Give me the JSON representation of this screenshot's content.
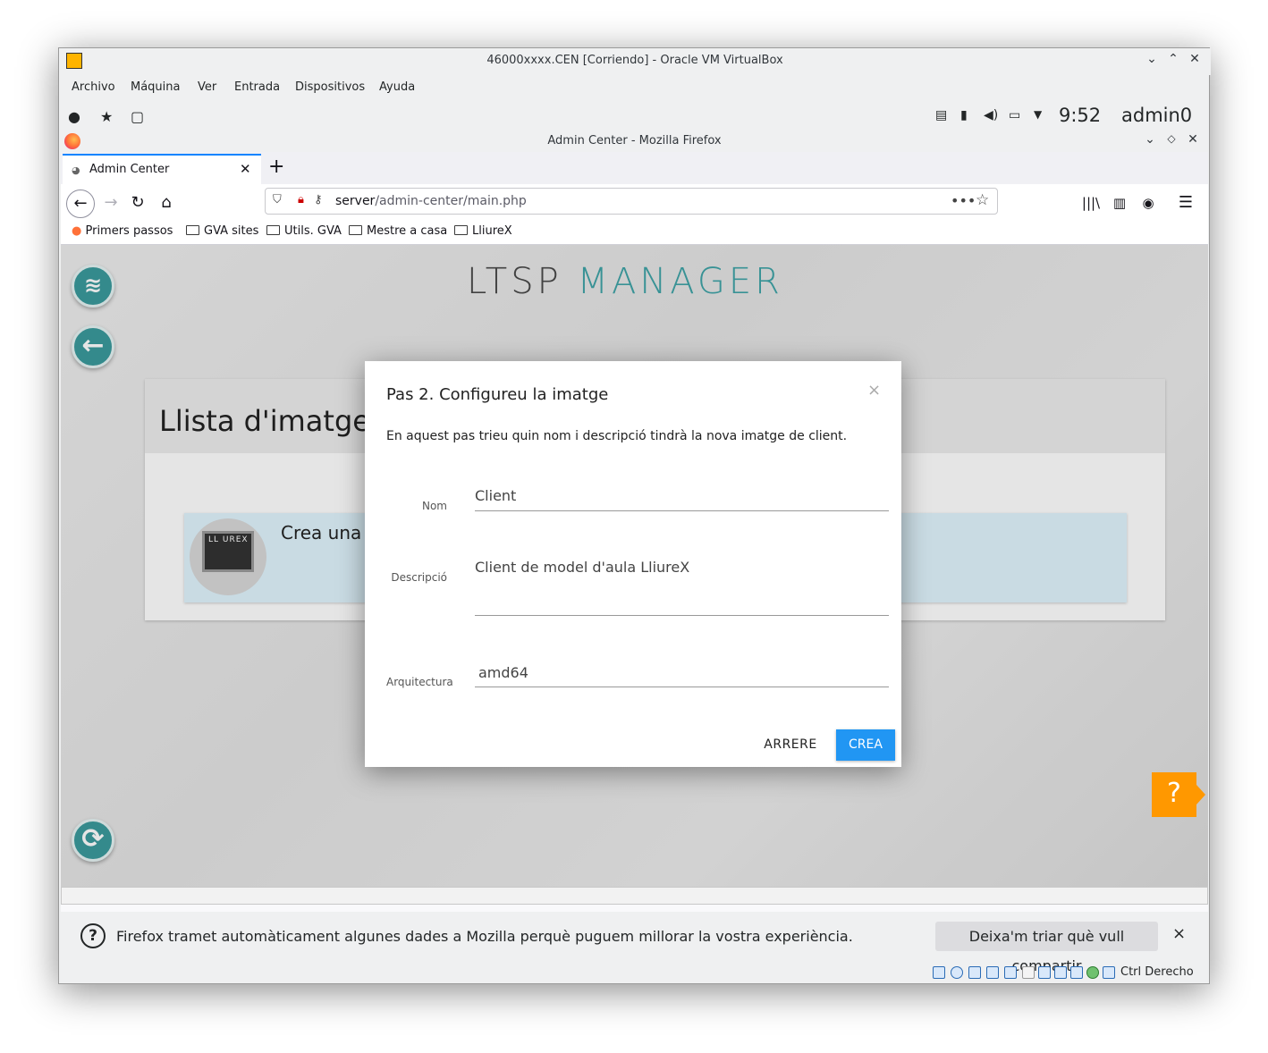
{
  "vbox": {
    "title": "46000xxxx.CEN [Corriendo] - Oracle VM VirtualBox",
    "menu": [
      "Archivo",
      "Máquina",
      "Ver",
      "Entrada",
      "Dispositivos",
      "Ayuda"
    ],
    "clock": "9:52",
    "user": "admin0",
    "host_key": "Ctrl Derecho"
  },
  "firefox": {
    "title": "Admin Center - Mozilla Firefox",
    "tab_label": "Admin Center",
    "url_host": "server",
    "url_path": "/admin-center/main.php",
    "bookmarks": [
      "Primers passos",
      "GVA sites",
      "Utils. GVA",
      "Mestre a casa",
      "LliureX"
    ]
  },
  "page": {
    "logo_left": "LTSP",
    "logo_right": "MANAGER",
    "card_title": "Llista d'imatges",
    "item_text": "Crea una n",
    "item_image_text": "LL UREX",
    "help": "?"
  },
  "modal": {
    "title": "Pas 2. Configureu la imatge",
    "close": "×",
    "description": "En aquest pas trieu quin nom i descripció tindrà la nova imatge de client.",
    "fields": {
      "name_label": "Nom",
      "name_value": "Client",
      "desc_label": "Descripció",
      "desc_value": "Client de model d'aula LliureX",
      "arch_label": "Arquitectura",
      "arch_value": "amd64"
    },
    "back_label": "ARRERE",
    "create_label": "CREA"
  },
  "notification": {
    "text": "Firefox tramet automàticament algunes dades a Mozilla perquè puguem millorar la vostra experiència.",
    "button": "Deixa'm triar què vull compartir",
    "close": "×"
  },
  "colors": {
    "accent": "#2196f3",
    "teal": "#3fa3a6",
    "help": "#ff9800"
  }
}
